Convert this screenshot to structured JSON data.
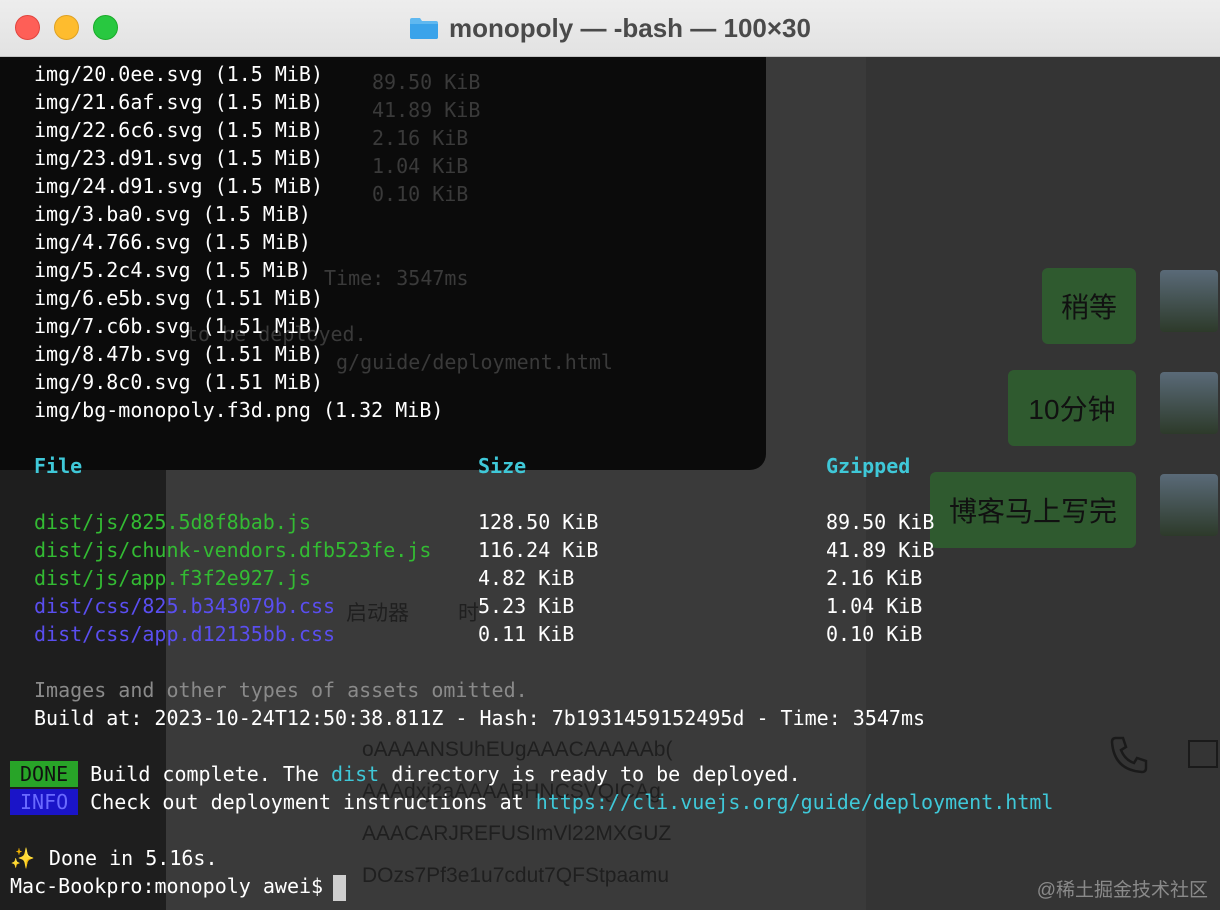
{
  "window": {
    "title": "monopoly — -bash — 100×30"
  },
  "asset_lines": [
    "img/20.0ee.svg (1.5 MiB)",
    "img/21.6af.svg (1.5 MiB)",
    "img/22.6c6.svg (1.5 MiB)",
    "img/23.d91.svg (1.5 MiB)",
    "img/24.d91.svg (1.5 MiB)",
    "img/3.ba0.svg (1.5 MiB)",
    "img/4.766.svg (1.5 MiB)",
    "img/5.2c4.svg (1.5 MiB)",
    "img/6.e5b.svg (1.51 MiB)",
    "img/7.c6b.svg (1.51 MiB)",
    "img/8.47b.svg (1.51 MiB)",
    "img/9.8c0.svg (1.51 MiB)",
    "img/bg-monopoly.f3d.png (1.32 MiB)"
  ],
  "table": {
    "headers": {
      "file": "File",
      "size": "Size",
      "gzipped": "Gzipped"
    },
    "rows": [
      {
        "file": "dist/js/825.5d8f8bab.js",
        "size": "128.50 KiB",
        "gzipped": "89.50 KiB",
        "color": "green"
      },
      {
        "file": "dist/js/chunk-vendors.dfb523fe.js",
        "size": "116.24 KiB",
        "gzipped": "41.89 KiB",
        "color": "green"
      },
      {
        "file": "dist/js/app.f3f2e927.js",
        "size": "4.82 KiB",
        "gzipped": "2.16 KiB",
        "color": "green"
      },
      {
        "file": "dist/css/825.b343079b.css",
        "size": "5.23 KiB",
        "gzipped": "1.04 KiB",
        "color": "blue"
      },
      {
        "file": "dist/css/app.d12135bb.css",
        "size": "0.11 KiB",
        "gzipped": "0.10 KiB",
        "color": "blue"
      }
    ]
  },
  "omitted_note": "Images and other types of assets omitted.",
  "build_line": "Build at: 2023-10-24T12:50:38.811Z - Hash: 7b1931459152495d - Time: 3547ms",
  "done_tag": "DONE",
  "done_msg_prefix": "Build complete. The ",
  "done_msg_dir": "dist",
  "done_msg_suffix": " directory is ready to be deployed.",
  "info_tag": "INFO",
  "info_msg_prefix": "Check out deployment instructions at ",
  "info_url": "https://cli.vuejs.org/guide/deployment.html",
  "sparkle": "✨",
  "done_time": "Done in 5.16s.",
  "prompt": "Mac-Bookpro:monopoly awei$",
  "background": {
    "ghost_sizes": [
      "89.50 KiB",
      "41.89 KiB",
      "2.16 KiB",
      "1.04 KiB",
      "0.10 KiB"
    ],
    "ghost_time": "Time: 3547ms",
    "ghost_deployed": "to be deployed.",
    "ghost_url": "g/guide/deployment.html",
    "ghost_menu": "启动器",
    "ghost_menu2": "时",
    "ghost_base64": [
      "oAAAANSUhEUgAAACAAAAAb(",
      "AAAdxj2aAAAABHNCSVQICAg",
      "AAACARJREFUSImVl22MXGUZ",
      "DOzs7Pf3e1u7cdut7QFStpaamu"
    ],
    "chat_bubbles": [
      "稍等",
      "10分钟",
      "博客马上写完"
    ],
    "watermark": "@稀土掘金技术社区"
  }
}
